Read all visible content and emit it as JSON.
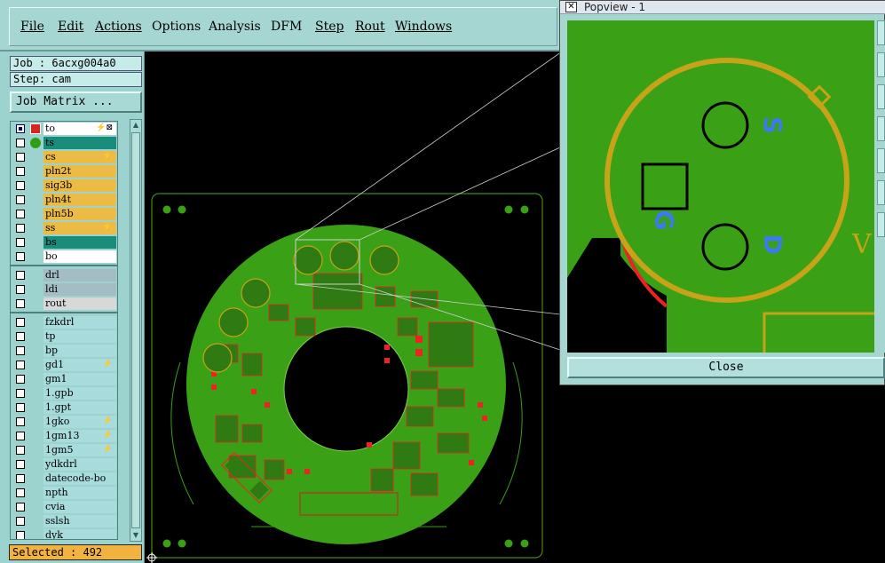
{
  "menu": [
    "File",
    "Edit",
    "Actions",
    "Options",
    "Analysis",
    "DFM",
    "Step",
    "Rout",
    "Windows"
  ],
  "job_label": "Job : 6acxg004a0",
  "step_label": "Step: cam",
  "job_matrix_label": "Job Matrix ...",
  "layers": [
    {
      "name": "to",
      "color": "white",
      "checked": true,
      "flag": "⚡⊠"
    },
    {
      "name": "ts",
      "color": "teal",
      "checked": false,
      "flag": ""
    },
    {
      "name": "cs",
      "color": "orange",
      "checked": false,
      "flag": "⚡"
    },
    {
      "name": "pln2t",
      "color": "orange",
      "checked": false,
      "flag": ""
    },
    {
      "name": "sig3b",
      "color": "orange",
      "checked": false,
      "flag": ""
    },
    {
      "name": "pln4t",
      "color": "orange",
      "checked": false,
      "flag": ""
    },
    {
      "name": "pln5b",
      "color": "orange",
      "checked": false,
      "flag": ""
    },
    {
      "name": "ss",
      "color": "orange",
      "checked": false,
      "flag": "⚡"
    },
    {
      "name": "bs",
      "color": "teal",
      "checked": false,
      "flag": ""
    },
    {
      "name": "bo",
      "color": "white",
      "checked": false,
      "flag": ""
    },
    {
      "name": "drl",
      "color": "gray",
      "checked": false,
      "flag": ""
    },
    {
      "name": "ldi",
      "color": "gray",
      "checked": false,
      "flag": ""
    },
    {
      "name": "rout",
      "color": "lgray",
      "checked": false,
      "flag": ""
    },
    {
      "name": "fzkdrl",
      "color": "cyan",
      "checked": false,
      "flag": ""
    },
    {
      "name": "tp",
      "color": "cyan",
      "checked": false,
      "flag": ""
    },
    {
      "name": "bp",
      "color": "cyan",
      "checked": false,
      "flag": ""
    },
    {
      "name": "gd1",
      "color": "cyan",
      "checked": false,
      "flag": "⚡"
    },
    {
      "name": "gm1",
      "color": "cyan",
      "checked": false,
      "flag": ""
    },
    {
      "name": "1.gpb",
      "color": "cyan",
      "checked": false,
      "flag": ""
    },
    {
      "name": "1.gpt",
      "color": "cyan",
      "checked": false,
      "flag": ""
    },
    {
      "name": "1gko",
      "color": "cyan",
      "checked": false,
      "flag": "⚡"
    },
    {
      "name": "1gm13",
      "color": "cyan",
      "checked": false,
      "flag": "⚡"
    },
    {
      "name": "1gm5",
      "color": "cyan",
      "checked": false,
      "flag": "⚡"
    },
    {
      "name": "ydkdrl",
      "color": "cyan",
      "checked": false,
      "flag": ""
    },
    {
      "name": "datecode-bo",
      "color": "cyan",
      "checked": false,
      "flag": ""
    },
    {
      "name": "npth",
      "color": "cyan",
      "checked": false,
      "flag": ""
    },
    {
      "name": "cvia",
      "color": "cyan",
      "checked": false,
      "flag": ""
    },
    {
      "name": "sslsh",
      "color": "cyan",
      "checked": false,
      "flag": ""
    },
    {
      "name": "dyk",
      "color": "cyan",
      "checked": false,
      "flag": ""
    }
  ],
  "selected_label": "Selected : 492",
  "popview": {
    "title": "Popview - 1",
    "close_label": "Close",
    "pin_labels": [
      "S",
      "G",
      "D"
    ],
    "edge_letter": "V"
  }
}
